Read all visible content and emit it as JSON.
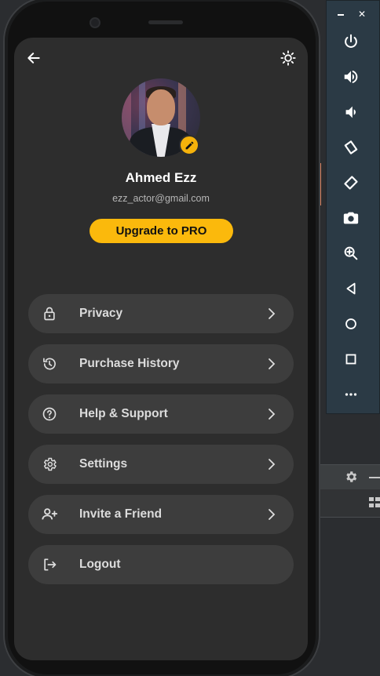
{
  "profile": {
    "name": "Ahmed Ezz",
    "email": "ezz_actor@gmail.com",
    "upgrade_label": "Upgrade to PRO"
  },
  "topbar": {
    "back_icon": "arrow-back-icon",
    "theme_icon": "brightness-icon"
  },
  "menu": [
    {
      "label": "Privacy",
      "icon": "lock-icon"
    },
    {
      "label": "Purchase History",
      "icon": "history-icon"
    },
    {
      "label": "Help & Support",
      "icon": "help-circle-icon"
    },
    {
      "label": "Settings",
      "icon": "gear-icon"
    },
    {
      "label": "Invite a Friend",
      "icon": "person-add-icon"
    },
    {
      "label": "Logout",
      "icon": "logout-icon"
    }
  ],
  "emulator_controls": [
    "power-icon",
    "volume-up-icon",
    "volume-down-icon",
    "rotate-left-icon",
    "rotate-right-icon",
    "camera-icon",
    "zoom-icon",
    "back-triangle-icon",
    "home-circle-icon",
    "overview-square-icon",
    "more-icon"
  ],
  "colors": {
    "accent": "#fbb90c",
    "screen_bg": "#2d2d2d",
    "menu_item_bg": "#3d3d3d",
    "emulator_panel": "#2b3a45"
  }
}
